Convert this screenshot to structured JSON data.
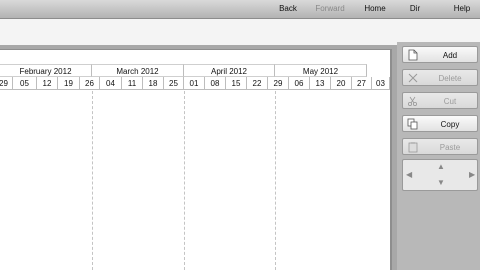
{
  "toolbar": {
    "items": [
      {
        "label": "Back",
        "enabled": true
      },
      {
        "label": "Forward",
        "enabled": false
      },
      {
        "label": "Home",
        "enabled": true
      },
      {
        "label": "Dir",
        "enabled": true
      },
      {
        "label": "Help",
        "enabled": true
      }
    ]
  },
  "calendar": {
    "months": [
      "February 2012",
      "March 2012",
      "April 2012",
      "May 2012"
    ],
    "weeks": [
      "29",
      "05",
      "12",
      "19",
      "26",
      "04",
      "11",
      "18",
      "25",
      "01",
      "08",
      "15",
      "22",
      "29",
      "06",
      "13",
      "20",
      "27",
      "03"
    ]
  },
  "side_panel": {
    "buttons": [
      {
        "label": "Add",
        "enabled": true,
        "icon": "document-icon"
      },
      {
        "label": "Delete",
        "enabled": false,
        "icon": "x-icon"
      },
      {
        "label": "Cut",
        "enabled": false,
        "icon": "scissors-icon"
      },
      {
        "label": "Copy",
        "enabled": true,
        "icon": "copy-icon"
      },
      {
        "label": "Paste",
        "enabled": false,
        "icon": "paste-icon"
      }
    ],
    "navpad": [
      "left-arrow-icon",
      "up-arrow-icon",
      "down-arrow-icon",
      "right-arrow-icon"
    ]
  }
}
